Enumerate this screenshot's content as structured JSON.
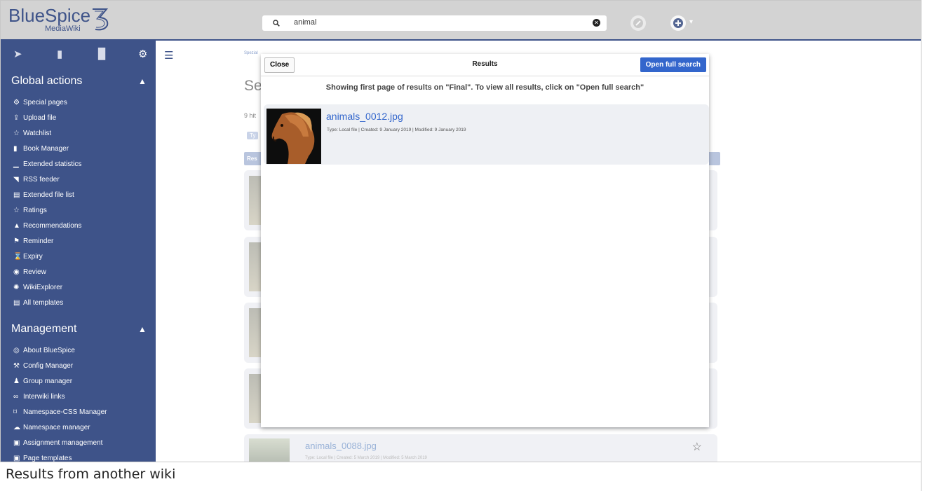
{
  "header": {
    "logo_word": "BlueSpice",
    "logo_sub": "MediaWiki",
    "search_value": "animal"
  },
  "sidebar": {
    "global_actions": {
      "title": "Global actions",
      "items": [
        {
          "label": "Special pages",
          "icon": "special-pages-icon",
          "glyph": "⚙"
        },
        {
          "label": "Upload file",
          "icon": "upload-icon",
          "glyph": "⇪"
        },
        {
          "label": "Watchlist",
          "icon": "star-icon",
          "glyph": "☆"
        },
        {
          "label": "Book Manager",
          "icon": "book-icon",
          "glyph": "▮"
        },
        {
          "label": "Extended statistics",
          "icon": "chart-icon",
          "glyph": "▁"
        },
        {
          "label": "RSS feeder",
          "icon": "rss-icon",
          "glyph": "◥"
        },
        {
          "label": "Extended file list",
          "icon": "list-icon",
          "glyph": "▤"
        },
        {
          "label": "Ratings",
          "icon": "star-icon",
          "glyph": "☆"
        },
        {
          "label": "Recommendations",
          "icon": "recommend-icon",
          "glyph": "▲"
        },
        {
          "label": "Reminder",
          "icon": "flag-icon",
          "glyph": "⚑"
        },
        {
          "label": "Expiry",
          "icon": "hourglass-icon",
          "glyph": "⌛"
        },
        {
          "label": "Review",
          "icon": "eye-icon",
          "glyph": "◉"
        },
        {
          "label": "WikiExplorer",
          "icon": "compass-icon",
          "glyph": "✺"
        },
        {
          "label": "All templates",
          "icon": "template-icon",
          "glyph": "▤"
        }
      ]
    },
    "management": {
      "title": "Management",
      "items": [
        {
          "label": "About BlueSpice",
          "icon": "info-icon",
          "glyph": "◎"
        },
        {
          "label": "Config Manager",
          "icon": "wrench-icon",
          "glyph": "⚒"
        },
        {
          "label": "Group manager",
          "icon": "group-icon",
          "glyph": "♟"
        },
        {
          "label": "Interwiki links",
          "icon": "link-icon",
          "glyph": "∞"
        },
        {
          "label": "Namespace-CSS Manager",
          "icon": "paint-icon",
          "glyph": "⌑"
        },
        {
          "label": "Namespace manager",
          "icon": "cloud-icon",
          "glyph": "☁"
        },
        {
          "label": "Assignment management",
          "icon": "assign-icon",
          "glyph": "▣"
        },
        {
          "label": "Page templates",
          "icon": "page-icon",
          "glyph": "▣"
        }
      ]
    }
  },
  "background": {
    "breadcrumb": "Spezial",
    "heading_partial": "Se",
    "hits_partial": "9 hit",
    "ty_partial": "Ty",
    "res_partial": "Res",
    "card5_title": "animals_0088.jpg",
    "card5_meta": "Type: Local file | Created: 5 March 2019 | Modified: 5 March 2019"
  },
  "dialog": {
    "close_label": "Close",
    "title": "Results",
    "open_full_label": "Open full search",
    "notice": "Showing first page of results on \"Final\". To view all results, click on \"Open full search\"",
    "result": {
      "title": "animals_0012.jpg",
      "meta": "Type: Local file | Created: 9 January 2019 | Modified: 9 January 2019"
    }
  },
  "caption": "Results from another wiki"
}
